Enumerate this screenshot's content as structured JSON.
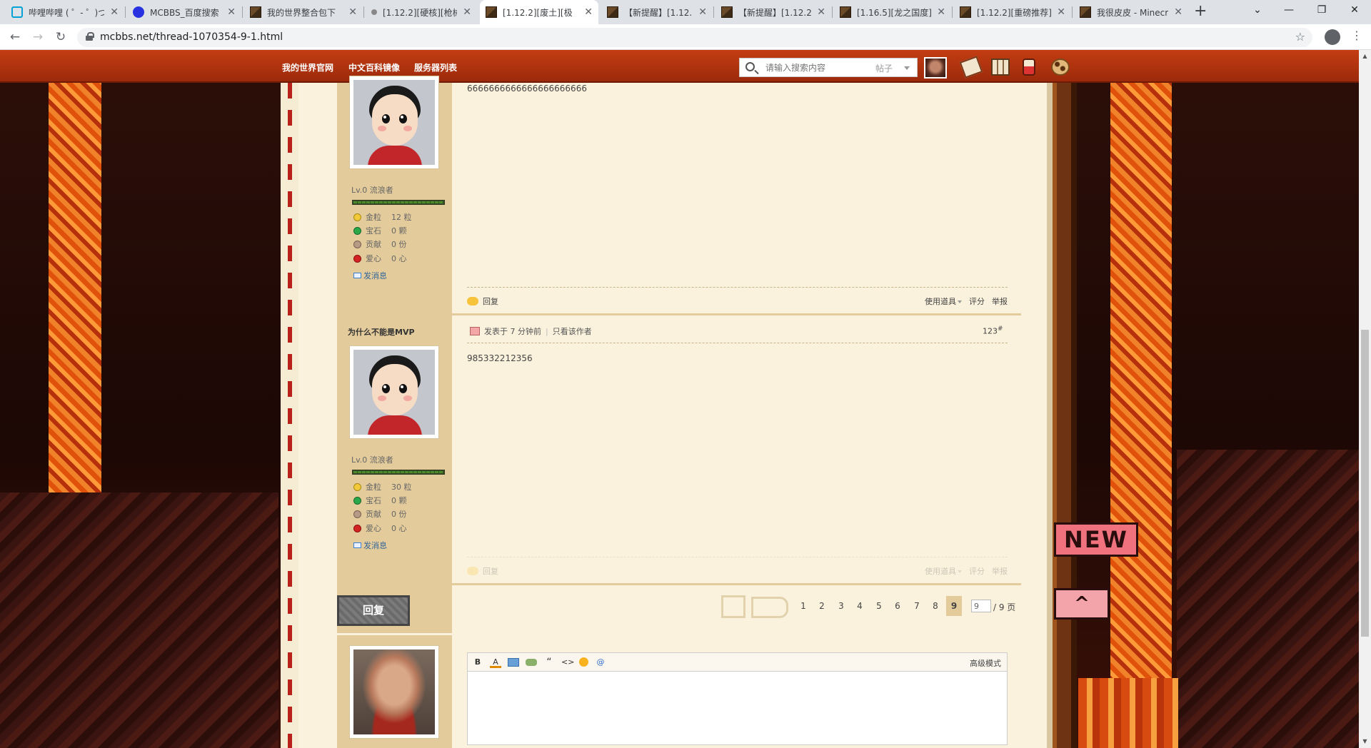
{
  "browser": {
    "tabs": [
      {
        "title": "哔哩哔哩 ( ゜- ゜)つ",
        "icon": "bilibili-icon"
      },
      {
        "title": "MCBBS_百度搜索",
        "icon": "baidu-icon"
      },
      {
        "title": "我的世界整合包下",
        "icon": "minecraft-icon"
      },
      {
        "title": "[1.12.2][硬核][枪械",
        "icon": "loading-icon"
      },
      {
        "title": "[1.12.2][废土][极",
        "icon": "minecraft-icon"
      },
      {
        "title": "【新提醒】[1.12.2]",
        "icon": "minecraft-icon"
      },
      {
        "title": "【新提醒】[1.12.2]",
        "icon": "minecraft-icon"
      },
      {
        "title": "[1.16.5][龙之国度]",
        "icon": "minecraft-icon"
      },
      {
        "title": "[1.12.2][重磅推荐]",
        "icon": "minecraft-icon"
      },
      {
        "title": "我很皮皮 - Minecr",
        "icon": "minecraft-icon"
      }
    ],
    "active_tab_index": 4,
    "new_tab": "+",
    "url": "mcbbs.net/thread-1070354-9-1.html"
  },
  "site_header": {
    "links": [
      "我的世界官网",
      "中文百科镜像",
      "服务器列表"
    ],
    "search_placeholder": "请输入搜索内容",
    "search_type": "帖子"
  },
  "posts": [
    {
      "body": "6666666666666666666666",
      "level": "Lv.0 流浪者",
      "stats": [
        {
          "label": "金粒",
          "value": "12 粒"
        },
        {
          "label": "宝石",
          "value": "0 颗"
        },
        {
          "label": "贡献",
          "value": "0 份"
        },
        {
          "label": "爱心",
          "value": "0 心"
        }
      ],
      "send_message": "发消息",
      "reply": "回复",
      "use_tool": "使用道具",
      "rate": "评分",
      "report": "举报"
    },
    {
      "author": "为什么不能是MVP",
      "posted": "发表于 7 分钟前",
      "only_author": "只看该作者",
      "floor": "123",
      "floor_mark": "#",
      "body": "985332212356",
      "level": "Lv.0 流浪者",
      "stats": [
        {
          "label": "金粒",
          "value": "30 粒"
        },
        {
          "label": "宝石",
          "value": "0 颗"
        },
        {
          "label": "贡献",
          "value": "0 份"
        },
        {
          "label": "爱心",
          "value": "0 心"
        }
      ],
      "send_message": "发消息",
      "reply": "回复",
      "use_tool": "使用道具",
      "rate": "评分",
      "report": "举报"
    }
  ],
  "pagination": {
    "reply_button": "回复",
    "pages": [
      "1",
      "2",
      "3",
      "4",
      "5",
      "6",
      "7",
      "8",
      "9"
    ],
    "current": "9",
    "jump_value": "9",
    "total": "/ 9 页"
  },
  "editor": {
    "tools": [
      "B",
      "A",
      "img",
      "link",
      "“",
      "<>",
      "emoji",
      "@"
    ],
    "advanced": "高级模式"
  },
  "float_flags": {
    "new": "NEW",
    "top": "^"
  },
  "colors": {
    "header_orange": "#c43d12",
    "content_bg": "#fbf2dd",
    "sidebar_tan": "#e3cb9b"
  }
}
